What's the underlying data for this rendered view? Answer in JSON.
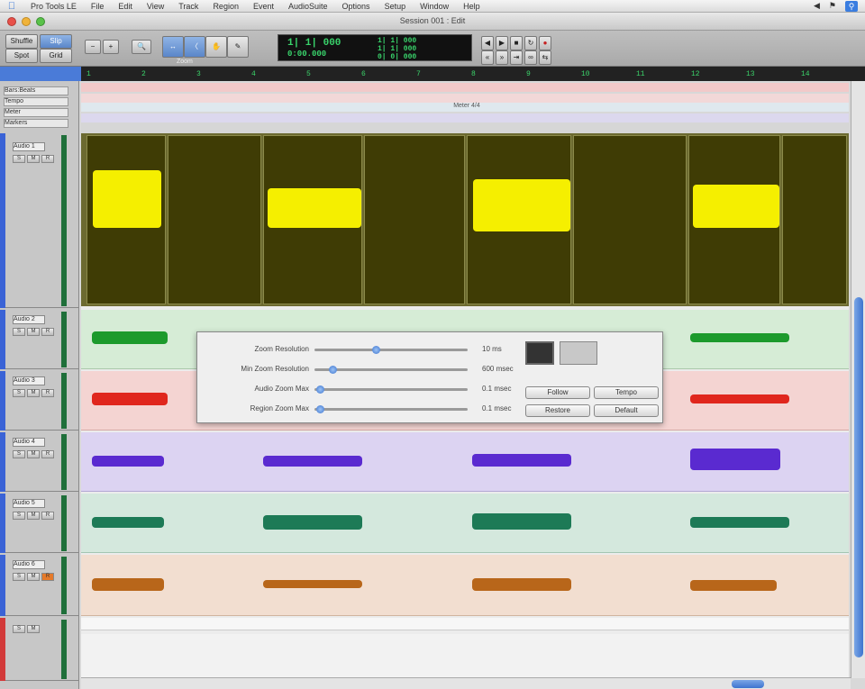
{
  "menubar": {
    "apple": "",
    "items": [
      "Pro Tools LE",
      "File",
      "Edit",
      "View",
      "Track",
      "Region",
      "Event",
      "AudioSuite",
      "Options",
      "Setup",
      "Window",
      "Help"
    ]
  },
  "window": {
    "title": "Session 001 : Edit"
  },
  "toolbar": {
    "modes": [
      "Shuffle",
      "Spot",
      "Slip",
      "Grid"
    ],
    "zoom_label": "Zoom",
    "counter": {
      "main": "1| 1| 000",
      "sub": "0:00.000",
      "start": "1| 1| 000",
      "end": "1| 1| 000",
      "length": "0| 0| 000"
    }
  },
  "ruler": {
    "bars": [
      "1",
      "2",
      "3",
      "4",
      "5",
      "6",
      "7",
      "8",
      "9",
      "10",
      "11",
      "12",
      "13",
      "14"
    ],
    "rows": [
      "Bars:Beats",
      "Tempo",
      "Meter",
      "Markers"
    ],
    "meter_label": "Meter 4/4"
  },
  "tracks": [
    {
      "name": "Audio 1",
      "color": "#f5ef00",
      "lane_bg": "#3d3a06"
    },
    {
      "name": "Audio 2",
      "color": "#1c9a2c",
      "lane_bg": "#d6ecd6"
    },
    {
      "name": "Audio 3",
      "color": "#e0261d",
      "lane_bg": "#f4d4d2"
    },
    {
      "name": "Audio 4",
      "color": "#5a2ad0",
      "lane_bg": "#dcd3f2"
    },
    {
      "name": "Audio 5",
      "color": "#1d7a56",
      "lane_bg": "#d4e8dd"
    },
    {
      "name": "Audio 6",
      "color": "#b8661a",
      "lane_bg": "#f2ded0"
    }
  ],
  "zoom_panel": {
    "rows": [
      {
        "label": "Zoom Resolution",
        "value": "10 ms"
      },
      {
        "label": "Min Zoom Resolution",
        "value": "600 msec"
      },
      {
        "label": "Audio Zoom Max",
        "value": "0.1 msec"
      },
      {
        "label": "Region Zoom Max",
        "value": "0.1 msec"
      }
    ],
    "buttons": [
      "Follow",
      "Tempo",
      "Restore",
      "Default"
    ]
  }
}
